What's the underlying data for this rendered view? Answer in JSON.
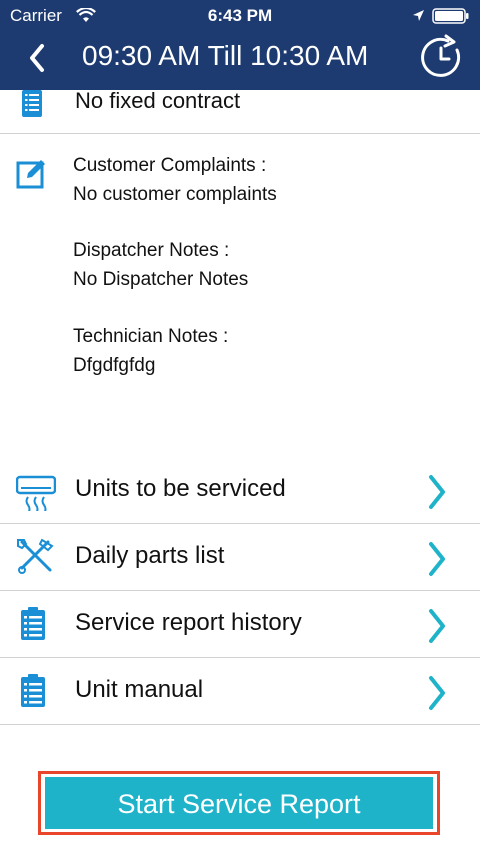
{
  "status_bar": {
    "carrier": "Carrier",
    "time": "6:43 PM"
  },
  "nav": {
    "title": "09:30 AM Till 10:30 AM"
  },
  "contract": {
    "label": "No fixed contract"
  },
  "notes": {
    "complaints_title": "Customer Complaints :",
    "complaints_value": "No customer complaints",
    "dispatcher_title": "Dispatcher Notes :",
    "dispatcher_value": "No Dispatcher Notes",
    "technician_title": "Technician Notes :",
    "technician_value": "Dfgdfgfdg"
  },
  "menu": {
    "items": [
      {
        "label": "Units to be serviced",
        "icon": "ac-unit-icon"
      },
      {
        "label": "Daily parts list",
        "icon": "tools-icon"
      },
      {
        "label": "Service report history",
        "icon": "clipboard-icon"
      },
      {
        "label": "Unit manual",
        "icon": "clipboard-icon"
      }
    ]
  },
  "action": {
    "start_label": "Start Service Report"
  },
  "colors": {
    "header": "#1d3b70",
    "accent": "#1fb3c9",
    "highlight": "#e8452a"
  }
}
